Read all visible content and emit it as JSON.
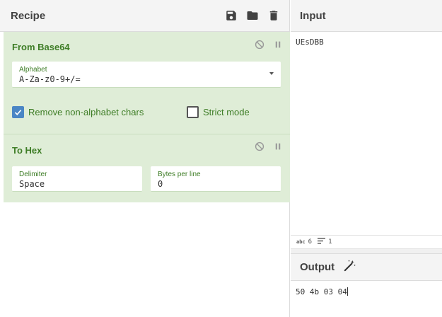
{
  "recipe": {
    "title": "Recipe",
    "icons": [
      "save-icon",
      "folder-icon",
      "trash-icon"
    ],
    "operations": [
      {
        "title": "From Base64",
        "alphabet": {
          "label": "Alphabet",
          "value": "A-Za-z0-9+/="
        },
        "remove_non_alphabet": {
          "label": "Remove non-alphabet chars",
          "checked": true
        },
        "strict_mode": {
          "label": "Strict mode",
          "checked": false
        }
      },
      {
        "title": "To Hex",
        "delimiter": {
          "label": "Delimiter",
          "value": "Space"
        },
        "bytes_per_line": {
          "label": "Bytes per line",
          "value": "0"
        }
      }
    ]
  },
  "input": {
    "title": "Input",
    "value": "UEsDBB",
    "status": {
      "length": "6",
      "lines": "1"
    }
  },
  "output": {
    "title": "Output",
    "value": "50 4b 03 04"
  },
  "colors": {
    "op_background": "#dfedd7",
    "op_text": "#3e7d26",
    "checkbox_checked": "#4a86c5"
  }
}
